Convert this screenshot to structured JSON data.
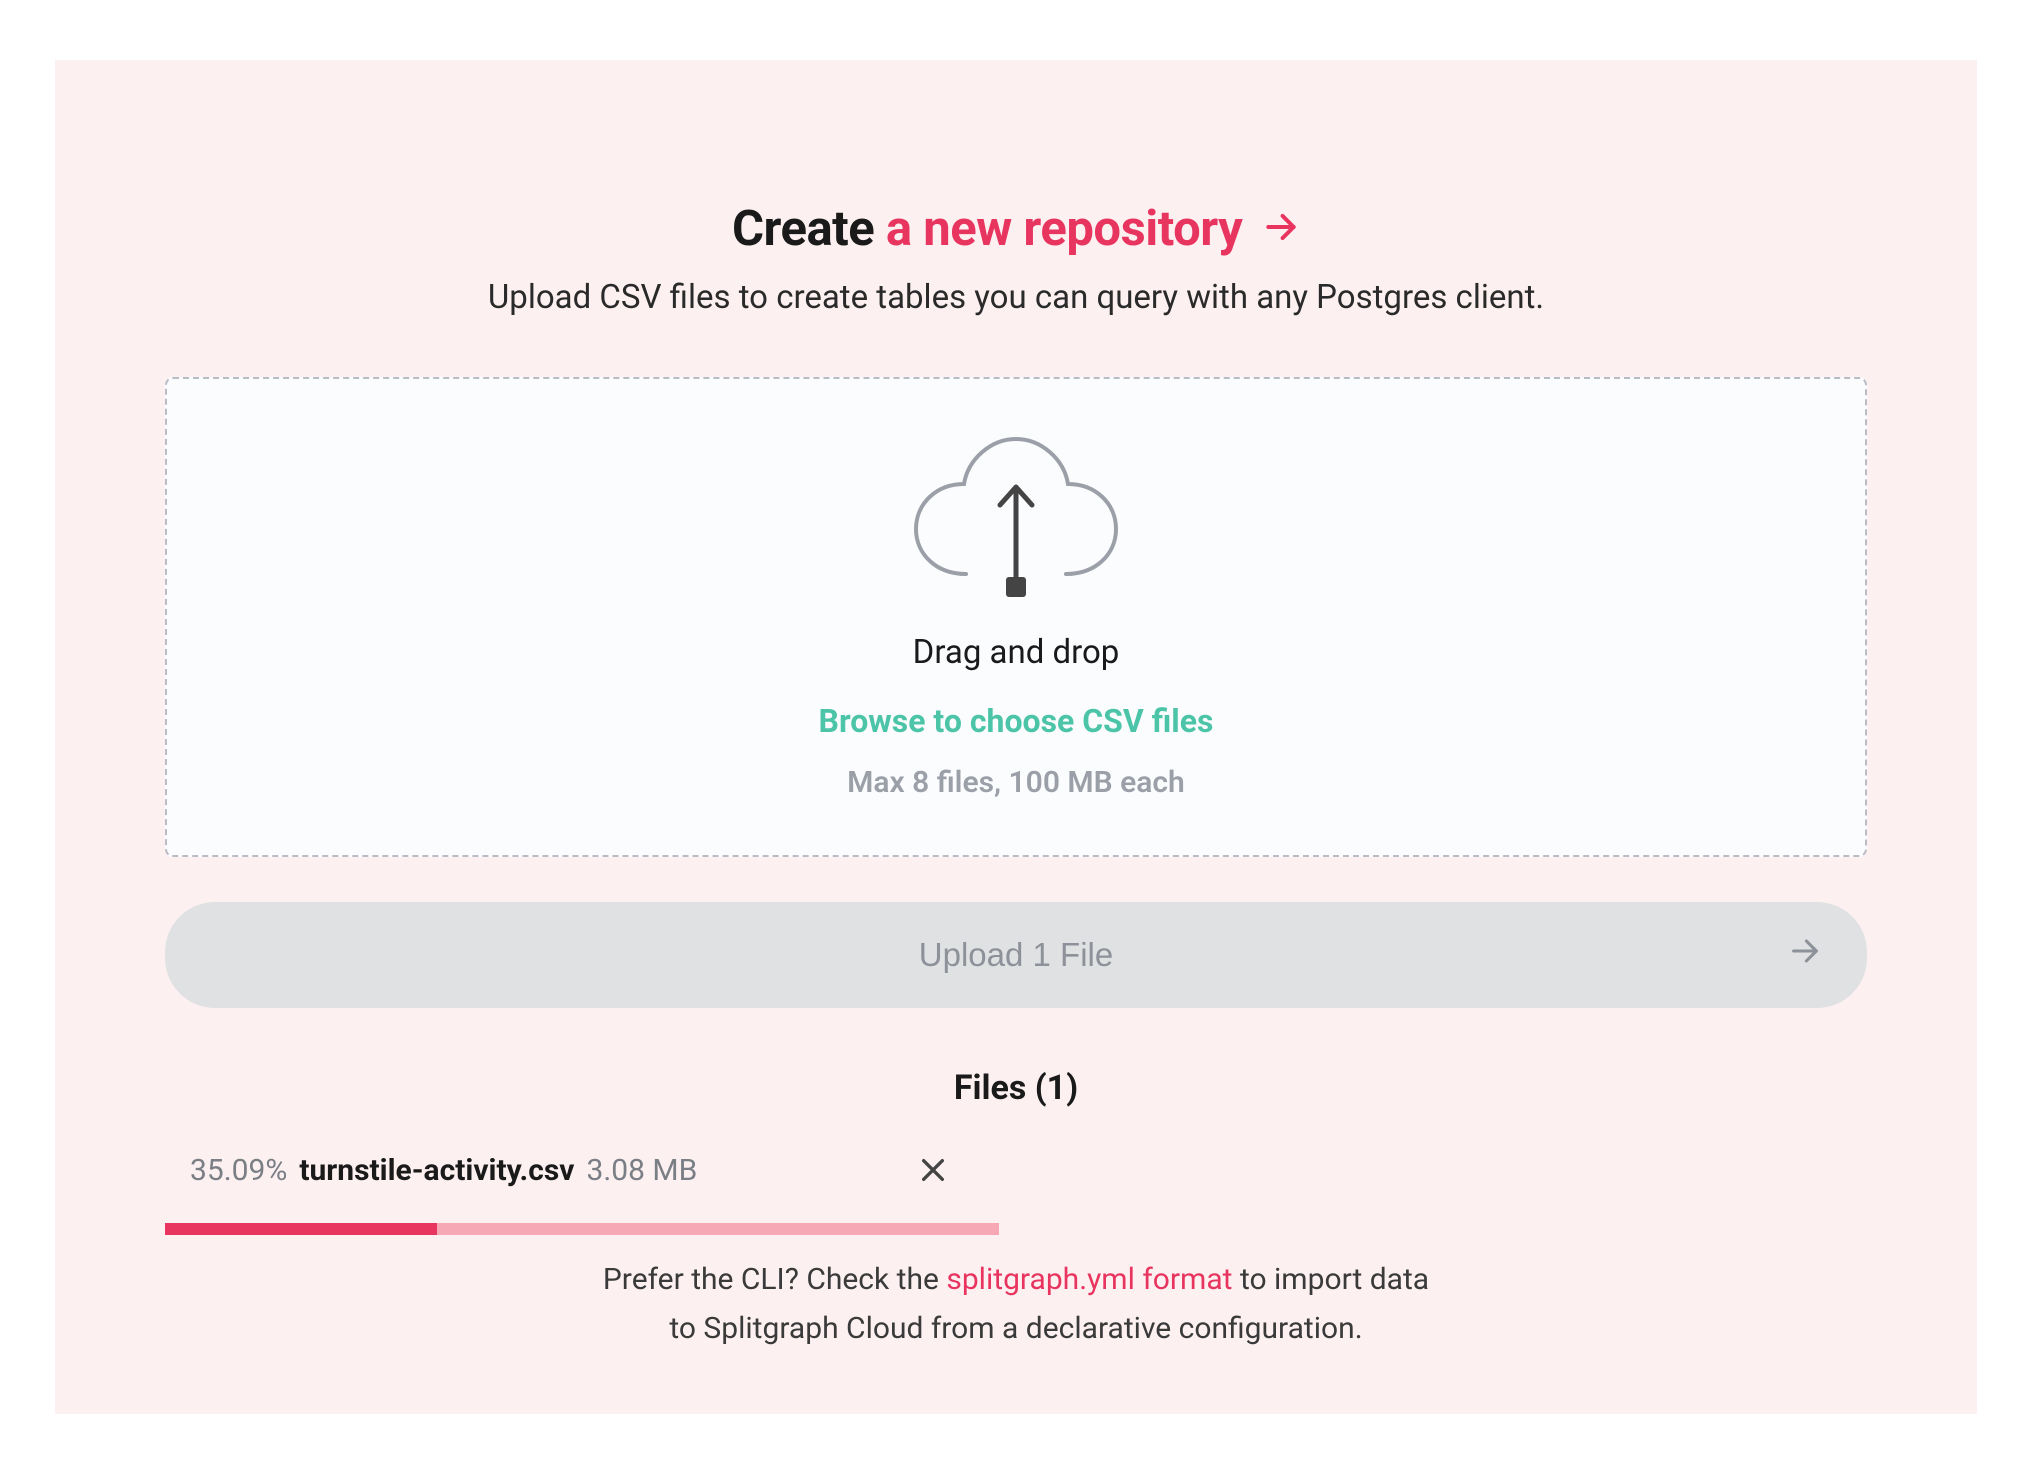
{
  "title": {
    "prefix": "Create",
    "link": "a new repository"
  },
  "subtitle": "Upload CSV files to create tables you can query with any Postgres client.",
  "dropzone": {
    "drag_text": "Drag and drop",
    "browse_text": "Browse to choose CSV files",
    "max_text": "Max 8 files, 100 MB each"
  },
  "upload_button": {
    "label": "Upload 1 File"
  },
  "files": {
    "header_label": "Files",
    "count": "(1)",
    "items": [
      {
        "percent": "35.09%",
        "name": "turnstile-activity.csv",
        "size": "3.08 MB",
        "progress_light_pct": 49,
        "progress_dark_pct": 16
      }
    ]
  },
  "cli": {
    "prefix": "Prefer the CLI? Check the ",
    "link": "splitgraph.yml format",
    "suffix": " to import data to Splitgraph Cloud from a declarative configuration."
  },
  "colors": {
    "accent": "#e8355f",
    "teal": "#4cc4a8",
    "progress_light": "#f6a8b5",
    "progress_dark": "#e8355f"
  }
}
